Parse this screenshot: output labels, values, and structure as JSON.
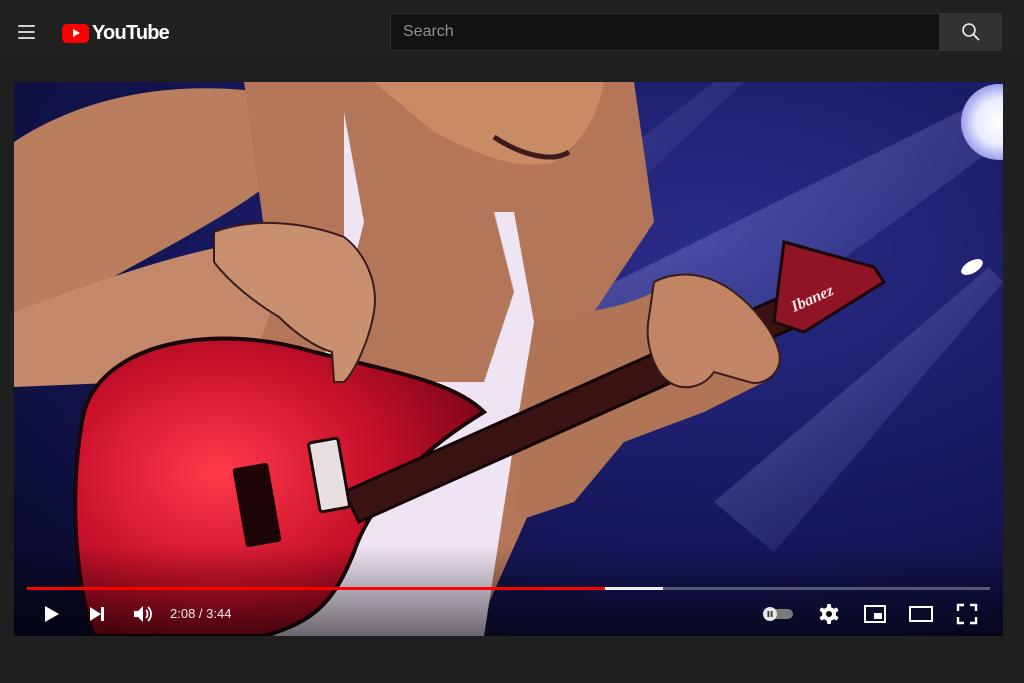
{
  "header": {
    "logo_text": "YouTube",
    "search": {
      "placeholder": "Search",
      "value": ""
    }
  },
  "player": {
    "artwork_text": "Ibanez",
    "time": {
      "current": "2:08",
      "duration": "3:44",
      "separator": " / "
    },
    "progress": {
      "played_fraction": 0.6,
      "buffered_fraction": 0.66
    },
    "colors": {
      "played": "#ff0000",
      "brand": "#ff0000"
    }
  },
  "icons": {
    "menu": "menu-icon",
    "search": "search-icon",
    "play": "play-icon",
    "next": "next-icon",
    "volume": "volume-icon",
    "autoplay": "autoplay-toggle-icon",
    "settings": "gear-icon",
    "miniplayer": "miniplayer-icon",
    "theater": "theater-mode-icon",
    "fullscreen": "fullscreen-icon"
  }
}
